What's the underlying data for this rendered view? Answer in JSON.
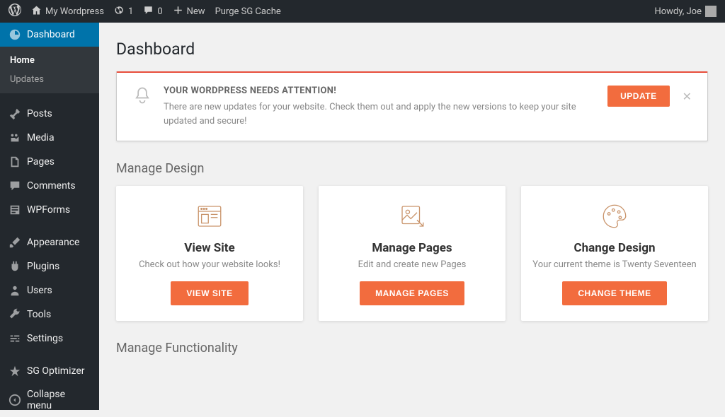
{
  "adminBar": {
    "siteName": "My Wordpress",
    "updatesCount": "1",
    "commentsCount": "0",
    "newLabel": "New",
    "purgeCacheLabel": "Purge SG Cache",
    "howdy": "Howdy, Joe"
  },
  "sidebar": {
    "dashboard": "Dashboard",
    "home": "Home",
    "updates": "Updates",
    "posts": "Posts",
    "media": "Media",
    "pages": "Pages",
    "comments": "Comments",
    "wpforms": "WPForms",
    "appearance": "Appearance",
    "plugins": "Plugins",
    "users": "Users",
    "tools": "Tools",
    "settings": "Settings",
    "sgOptimizer": "SG Optimizer",
    "collapse": "Collapse menu"
  },
  "page": {
    "title": "Dashboard"
  },
  "notice": {
    "title": "YOUR WORDPRESS NEEDS ATTENTION!",
    "text": "There are new updates for your website. Check them out and apply the new versions to keep your site updated and secure!",
    "button": "UPDATE"
  },
  "sections": {
    "manageDesign": "Manage Design",
    "manageFunctionality": "Manage Functionality"
  },
  "cards": {
    "viewSite": {
      "title": "View Site",
      "desc": "Check out how your website looks!",
      "button": "VIEW SITE"
    },
    "managePages": {
      "title": "Manage Pages",
      "desc": "Edit and create new Pages",
      "button": "MANAGE PAGES"
    },
    "changeDesign": {
      "title": "Change Design",
      "desc": "Your current theme is Twenty Seventeen",
      "button": "CHANGE THEME"
    }
  }
}
